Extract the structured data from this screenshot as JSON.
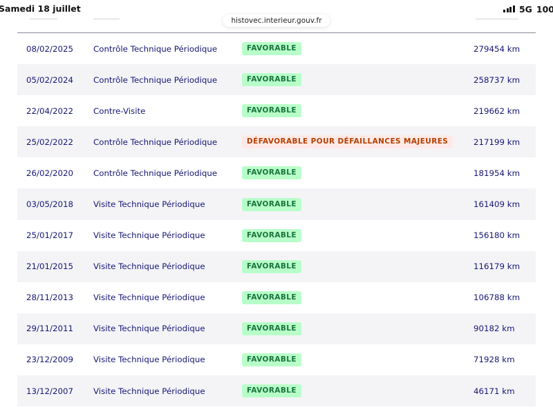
{
  "status_bar": {
    "left_text": "Samedi 18 juillet",
    "network": "5G",
    "battery": "100"
  },
  "browser": {
    "url": "histovec.interieur.gouv.fr"
  },
  "colors": {
    "text_blue": "#161676",
    "favorable_bg": "#b8fec9",
    "favorable_fg": "#18753c",
    "defavorable_bg": "#ffe9e6",
    "defavorable_fg": "#b34000",
    "row_alt_bg": "#f4f4f7"
  },
  "table": {
    "rows": [
      {
        "date": "08/02/2025",
        "type": "Contrôle Technique Périodique",
        "result": "FAVORABLE",
        "status": "ok",
        "km": "279454 km"
      },
      {
        "date": "05/02/2024",
        "type": "Contrôle Technique Périodique",
        "result": "FAVORABLE",
        "status": "ok",
        "km": "258737 km"
      },
      {
        "date": "22/04/2022",
        "type": "Contre-Visite",
        "result": "FAVORABLE",
        "status": "ok",
        "km": "219662 km"
      },
      {
        "date": "25/02/2022",
        "type": "Contrôle Technique Périodique",
        "result": "DÉFAVORABLE POUR DÉFAILLANCES MAJEURES",
        "status": "ko",
        "km": "217199 km"
      },
      {
        "date": "26/02/2020",
        "type": "Contrôle Technique Périodique",
        "result": "FAVORABLE",
        "status": "ok",
        "km": "181954 km"
      },
      {
        "date": "03/05/2018",
        "type": "Visite Technique Périodique",
        "result": "FAVORABLE",
        "status": "ok",
        "km": "161409 km"
      },
      {
        "date": "25/01/2017",
        "type": "Visite Technique Périodique",
        "result": "FAVORABLE",
        "status": "ok",
        "km": "156180 km"
      },
      {
        "date": "21/01/2015",
        "type": "Visite Technique Périodique",
        "result": "FAVORABLE",
        "status": "ok",
        "km": "116179 km"
      },
      {
        "date": "28/11/2013",
        "type": "Visite Technique Périodique",
        "result": "FAVORABLE",
        "status": "ok",
        "km": "106788 km"
      },
      {
        "date": "29/11/2011",
        "type": "Visite Technique Périodique",
        "result": "FAVORABLE",
        "status": "ok",
        "km": "90182 km"
      },
      {
        "date": "23/12/2009",
        "type": "Visite Technique Périodique",
        "result": "FAVORABLE",
        "status": "ok",
        "km": "71928 km"
      },
      {
        "date": "13/12/2007",
        "type": "Visite Technique Périodique",
        "result": "FAVORABLE",
        "status": "ok",
        "km": "46171 km"
      }
    ]
  }
}
